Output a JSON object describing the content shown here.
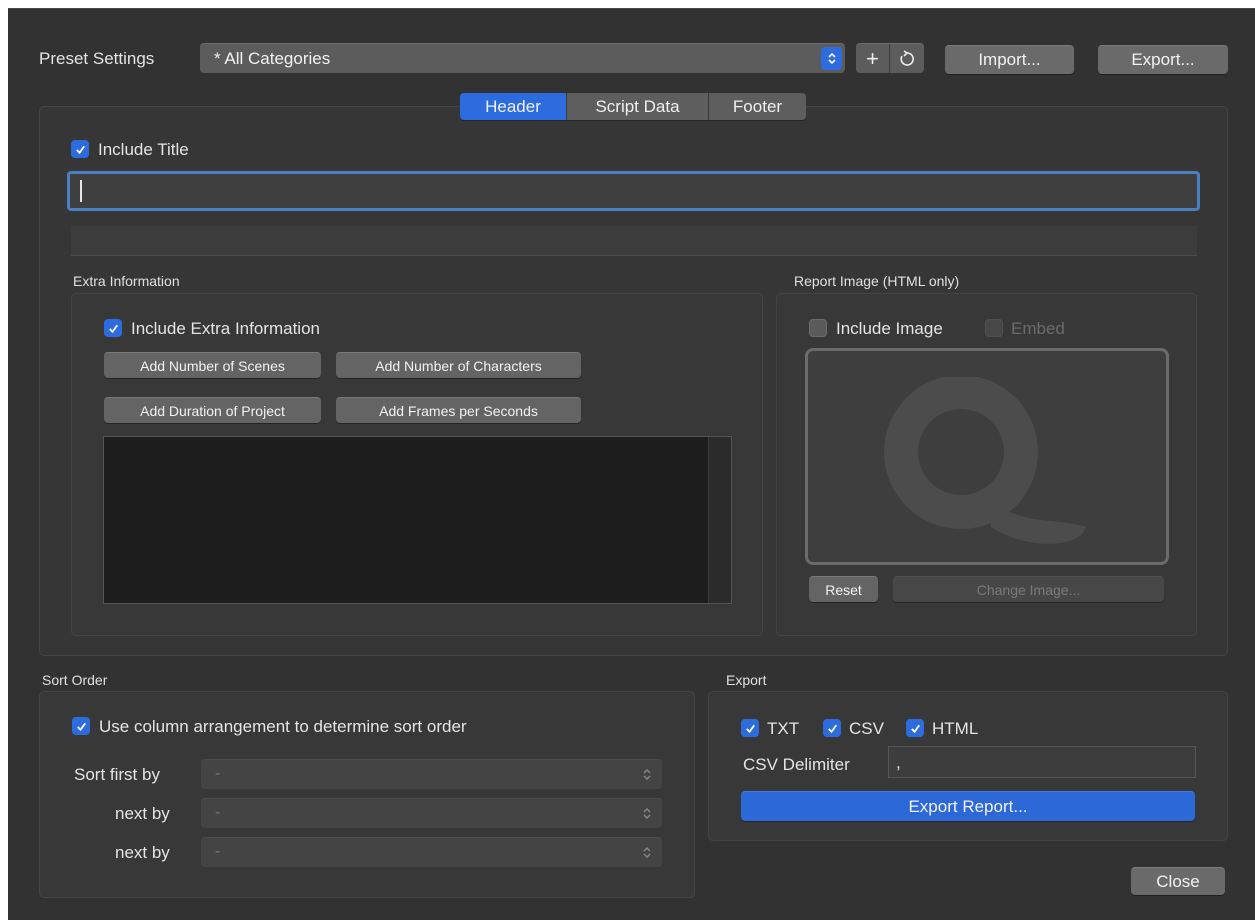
{
  "preset": {
    "label": "Preset Settings",
    "selected": "* All Categories",
    "add_symbol": "+",
    "import_label": "Import...",
    "export_label": "Export..."
  },
  "tabs": [
    {
      "label": "Header",
      "selected": true
    },
    {
      "label": "Script Data",
      "selected": false
    },
    {
      "label": "Footer",
      "selected": false
    }
  ],
  "header": {
    "include_title_label": "Include Title",
    "include_title_checked": true,
    "title_value": ""
  },
  "extra_info": {
    "group_title": "Extra Information",
    "include_label": "Include Extra Information",
    "include_checked": true,
    "buttons": [
      "Add Number of Scenes",
      "Add Number of Characters",
      "Add Duration of Project",
      "Add Frames per Seconds"
    ]
  },
  "report_image": {
    "group_title": "Report Image (HTML only)",
    "include_image_label": "Include Image",
    "include_image_checked": false,
    "embed_label": "Embed",
    "embed_checked": false,
    "reset_label": "Reset",
    "change_label": "Change Image..."
  },
  "sort_order": {
    "group_title": "Sort Order",
    "use_column_label": "Use column arrangement to determine sort order",
    "use_column_checked": true,
    "rows": [
      {
        "label": "Sort first by",
        "value": "-"
      },
      {
        "label": "next by",
        "value": "-"
      },
      {
        "label": "next by",
        "value": "-"
      }
    ]
  },
  "export": {
    "group_title": "Export",
    "formats": [
      {
        "label": "TXT",
        "checked": true
      },
      {
        "label": "CSV",
        "checked": true
      },
      {
        "label": "HTML",
        "checked": true
      }
    ],
    "delimiter_label": "CSV Delimiter",
    "delimiter_value": ",",
    "export_button": "Export Report..."
  },
  "close_label": "Close",
  "colors": {
    "accent": "#2d6cdf",
    "window_bg": "#323232"
  }
}
